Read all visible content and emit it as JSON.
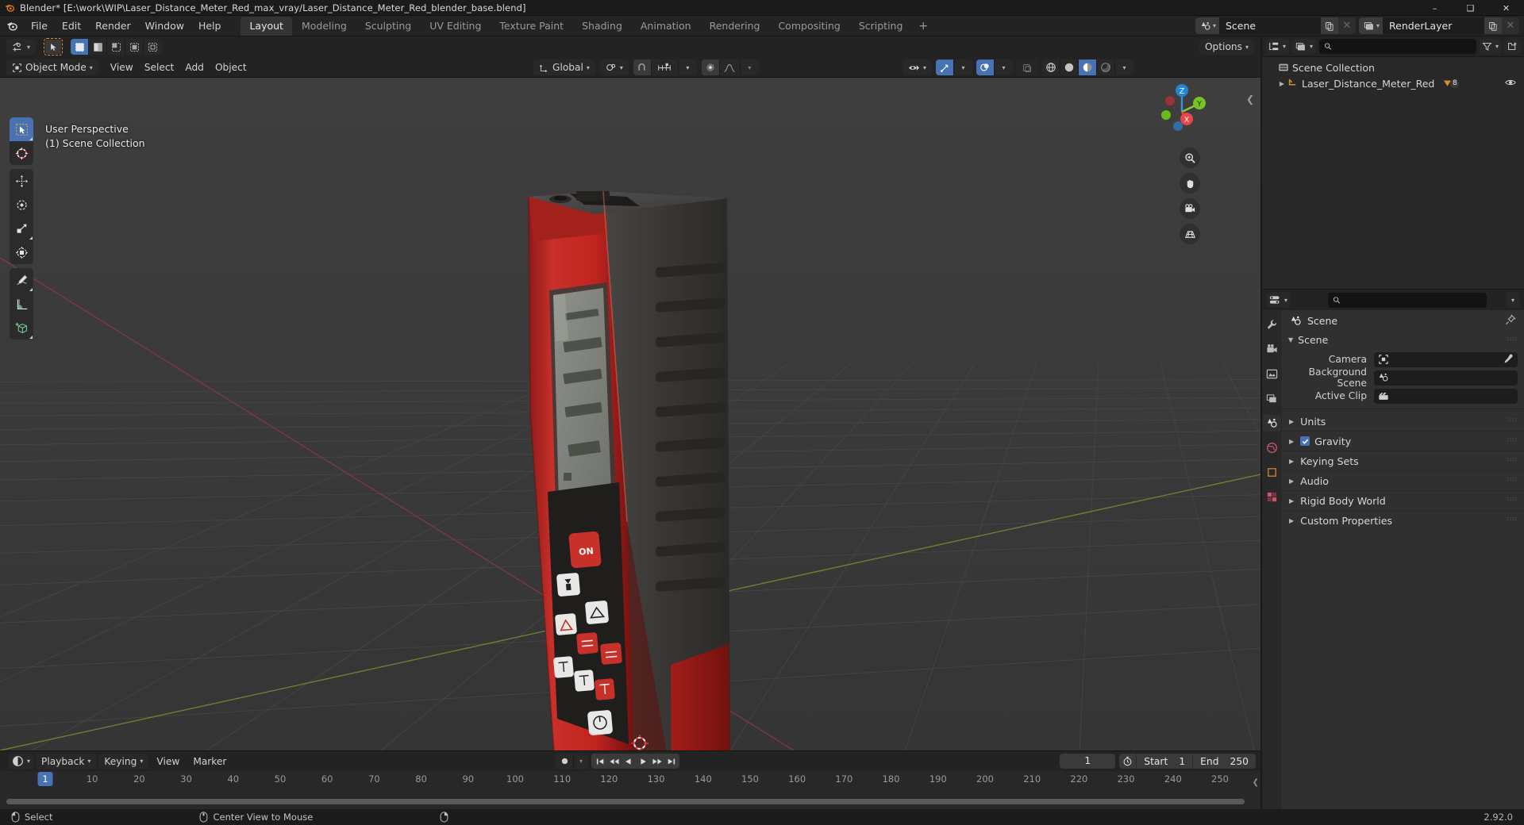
{
  "window": {
    "title": "Blender* [E:\\work\\WIP\\Laser_Distance_Meter_Red_max_vray/Laser_Distance_Meter_Red_blender_base.blend]",
    "minimize": "–",
    "maximize": "❑",
    "close": "✕"
  },
  "topbar": {
    "menus": [
      "File",
      "Edit",
      "Render",
      "Window",
      "Help"
    ],
    "workspaces": [
      {
        "label": "Layout",
        "active": true
      },
      {
        "label": "Modeling",
        "active": false
      },
      {
        "label": "Sculpting",
        "active": false
      },
      {
        "label": "UV Editing",
        "active": false
      },
      {
        "label": "Texture Paint",
        "active": false
      },
      {
        "label": "Shading",
        "active": false
      },
      {
        "label": "Animation",
        "active": false
      },
      {
        "label": "Rendering",
        "active": false
      },
      {
        "label": "Compositing",
        "active": false
      },
      {
        "label": "Scripting",
        "active": false
      }
    ],
    "add_workspace": "+",
    "scene_name": "Scene",
    "view_layer_name": "RenderLayer"
  },
  "viewport": {
    "mode": "Object Mode",
    "menus": [
      "View",
      "Select",
      "Add",
      "Object"
    ],
    "transform_orientation": "Global",
    "options_label": "Options",
    "overlay_line1": "User Perspective",
    "overlay_line2": "(1) Scene Collection",
    "gizmo_axes": [
      "X",
      "Y",
      "Z"
    ],
    "tools": [
      "tweak-select-tool",
      "cursor-tool",
      "move-tool",
      "rotate-tool",
      "scale-tool",
      "transform-tool",
      "annotate-tool",
      "measure-tool",
      "add-cube-tool"
    ]
  },
  "outliner": {
    "search_placeholder": "",
    "scene_collection": "Scene Collection",
    "items": [
      {
        "name": "Laser_Distance_Meter_Red",
        "modifier_count": "8"
      }
    ]
  },
  "properties": {
    "search_placeholder": "",
    "breadcrumb": "Scene",
    "panel_title": "Scene",
    "fields": [
      {
        "label": "Camera",
        "value": "",
        "icon": "camera-data-icon"
      },
      {
        "label": "Background Scene",
        "value": "",
        "icon": "scene-icon"
      },
      {
        "label": "Active Clip",
        "value": "",
        "icon": "movie-clip-icon"
      }
    ],
    "sections": [
      {
        "label": "Units",
        "checkbox": null
      },
      {
        "label": "Gravity",
        "checkbox": true
      },
      {
        "label": "Keying Sets",
        "checkbox": null
      },
      {
        "label": "Audio",
        "checkbox": null
      },
      {
        "label": "Rigid Body World",
        "checkbox": null
      },
      {
        "label": "Custom Properties",
        "checkbox": null
      }
    ]
  },
  "timeline": {
    "menus": [
      "Playback",
      "Keying",
      "View",
      "Marker"
    ],
    "current_frame": "1",
    "start_label": "Start",
    "start_value": "1",
    "end_label": "End",
    "end_value": "250",
    "ticks": [
      10,
      20,
      30,
      40,
      50,
      60,
      70,
      80,
      90,
      100,
      110,
      120,
      130,
      140,
      150,
      160,
      170,
      180,
      190,
      200,
      210,
      220,
      230,
      240,
      250
    ],
    "playhead_frame": "1"
  },
  "statusbar": {
    "items": [
      {
        "icon": "mouse-left-icon",
        "label": "Select"
      },
      {
        "icon": "mouse-middle-icon",
        "label": "Center View to Mouse"
      },
      {
        "icon": "mouse-right-icon",
        "label": ""
      }
    ],
    "version": "2.92.0"
  },
  "colors": {
    "accent": "#4772b3",
    "orange": "#e08a2b",
    "device_red": "#c22b27",
    "axis_x": "#e8464b",
    "axis_y": "#8fc831",
    "axis_z": "#3a8fe0"
  }
}
